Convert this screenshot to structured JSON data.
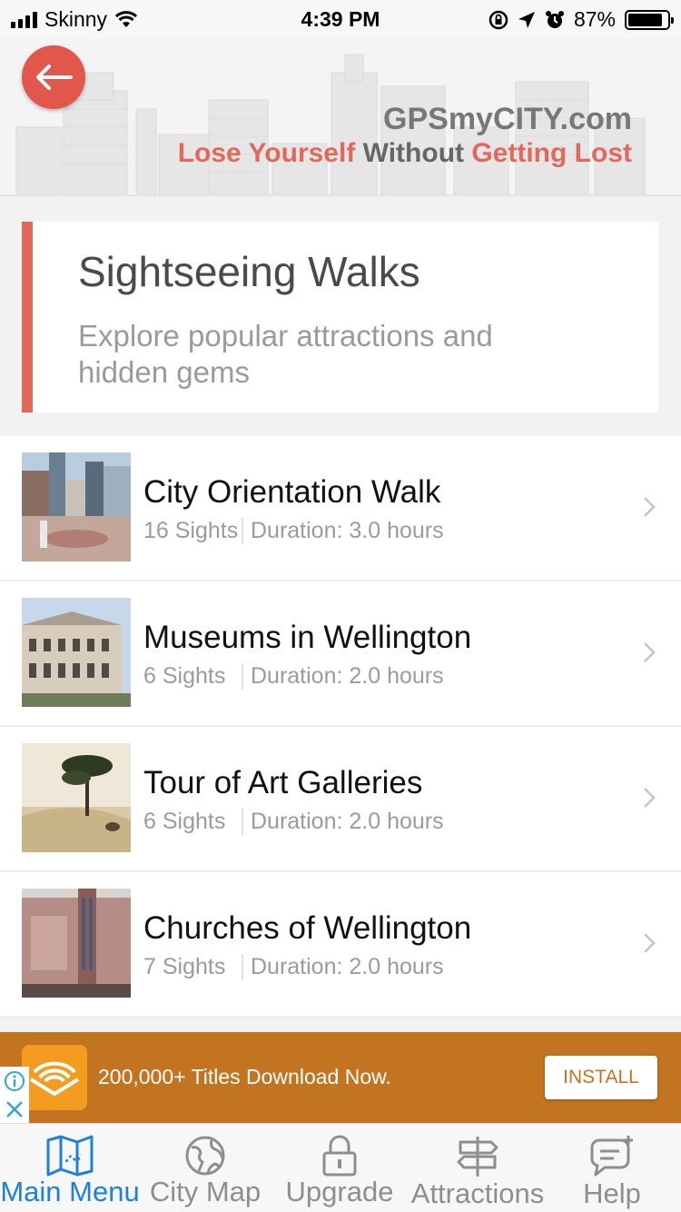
{
  "status_bar": {
    "carrier": "Skinny",
    "time": "4:39 PM",
    "battery": "87%",
    "battery_level": 0.87
  },
  "header": {
    "back_icon": "back-arrow-icon",
    "brand": "GPSmyCITY.com",
    "tagline_part1": "Lose Yourself",
    "tagline_part2": " Without ",
    "tagline_part3": "Getting Lost"
  },
  "section": {
    "title": "Sightseeing Walks",
    "subtitle": "Explore popular attractions and hidden gems"
  },
  "walks": [
    {
      "title": "City Orientation Walk",
      "sights": "16 Sights",
      "duration": "Duration: 3.0 hours"
    },
    {
      "title": "Museums in Wellington",
      "sights": "6 Sights",
      "duration": "Duration: 2.0 hours"
    },
    {
      "title": "Tour of Art Galleries",
      "sights": "6 Sights",
      "duration": "Duration: 2.0 hours"
    },
    {
      "title": "Churches of Wellington",
      "sights": "7 Sights",
      "duration": "Duration: 2.0 hours"
    }
  ],
  "ad": {
    "text": "200,000+ Titles Download Now.",
    "install": "INSTALL"
  },
  "tabs": [
    {
      "label": "Main Menu",
      "icon": "map-icon",
      "active": true
    },
    {
      "label": "City Map",
      "icon": "globe-icon",
      "active": false
    },
    {
      "label": "Upgrade",
      "icon": "lock-icon",
      "active": false
    },
    {
      "label": "Attractions",
      "icon": "signpost-icon",
      "active": false
    },
    {
      "label": "Help",
      "icon": "chat-icon",
      "active": false
    }
  ],
  "colors": {
    "accent": "#e2685c",
    "tab_active": "#1f7fe0",
    "ad_bg": "#c27420"
  }
}
